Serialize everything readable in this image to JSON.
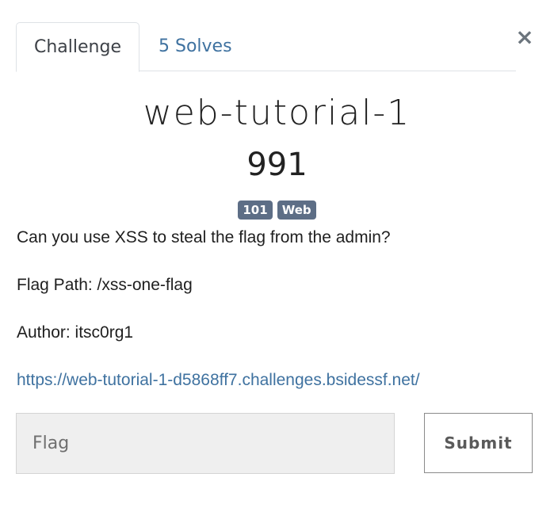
{
  "close": {
    "icon": "close-icon",
    "glyph": "×"
  },
  "tabs": [
    {
      "label": "Challenge",
      "active": true
    },
    {
      "label": "5 Solves",
      "active": false
    }
  ],
  "challenge": {
    "name": "web-tutorial-1",
    "value": "991",
    "tags": [
      "101",
      "Web"
    ],
    "description": [
      "Can you use XSS to steal the flag from the admin?",
      "Flag Path: /xss-one-flag",
      "Author: itsc0rg1"
    ],
    "link": "https://web-tutorial-1-d5868ff7.challenges.bsidessf.net/"
  },
  "form": {
    "flag_placeholder": "Flag",
    "submit_label": "Submit"
  },
  "colors": {
    "link": "#3f72a0",
    "tag_bg": "#5d6e86",
    "input_bg": "#efefef"
  }
}
